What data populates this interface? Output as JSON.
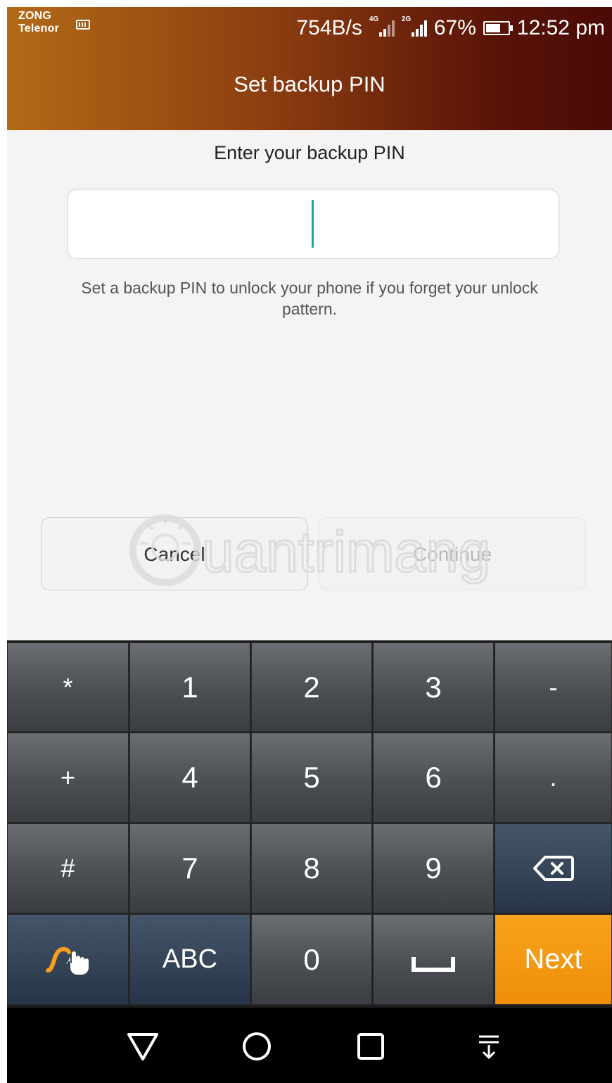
{
  "status_bar": {
    "carrier_1": "ZONG",
    "carrier_2": "Telenor",
    "speed": "754B/s",
    "sim1_type": "4G",
    "sim2_type": "2G",
    "battery": "67%",
    "time": "12:52 pm"
  },
  "title_bar": {
    "title": "Set backup PIN"
  },
  "content": {
    "prompt": "Enter your backup PIN",
    "pin_value": "",
    "helper_line_1": "Set a backup PIN to unlock your phone if you forget your unlock",
    "helper_line_2": "pattern."
  },
  "buttons": {
    "cancel": "Cancel",
    "continue": "Continue"
  },
  "watermark_text": "uantrimang",
  "keypad": {
    "rows": [
      [
        "*",
        "1",
        "2",
        "3",
        "-"
      ],
      [
        "+",
        "4",
        "5",
        "6",
        "."
      ],
      [
        "#",
        "7",
        "8",
        "9",
        "backspace"
      ],
      [
        "swipe",
        "ABC",
        "0",
        "space",
        "Next"
      ]
    ],
    "next_label": "Next",
    "abc_label": "ABC"
  },
  "colors": {
    "title_gradient_start": "#b36a16",
    "title_gradient_end": "#4a0a06",
    "cursor": "#19a9a6",
    "next_key": "#f7a21c"
  },
  "icons": [
    "keyboard-icon",
    "signal-icon",
    "battery-icon",
    "backspace-icon",
    "swipe-gesture-icon",
    "space-icon",
    "back-icon",
    "home-icon",
    "recents-icon",
    "notification-pull-icon"
  ]
}
